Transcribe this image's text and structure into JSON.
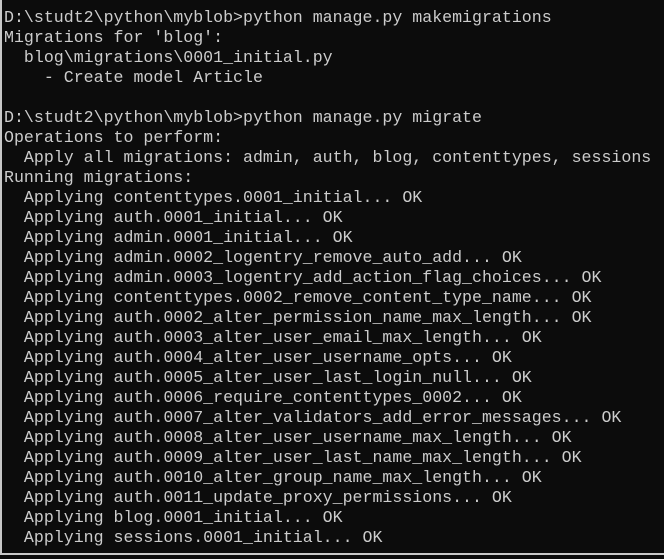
{
  "terminal": {
    "background": "#0c0c0c",
    "foreground": "#cccccc",
    "lines": [
      "D:\\studt2\\python\\myblob>python manage.py makemigrations",
      "Migrations for 'blog':",
      "  blog\\migrations\\0001_initial.py",
      "    - Create model Article",
      "",
      "D:\\studt2\\python\\myblob>python manage.py migrate",
      "Operations to perform:",
      "  Apply all migrations: admin, auth, blog, contenttypes, sessions",
      "Running migrations:",
      "  Applying contenttypes.0001_initial... OK",
      "  Applying auth.0001_initial... OK",
      "  Applying admin.0001_initial... OK",
      "  Applying admin.0002_logentry_remove_auto_add... OK",
      "  Applying admin.0003_logentry_add_action_flag_choices... OK",
      "  Applying contenttypes.0002_remove_content_type_name... OK",
      "  Applying auth.0002_alter_permission_name_max_length... OK",
      "  Applying auth.0003_alter_user_email_max_length... OK",
      "  Applying auth.0004_alter_user_username_opts... OK",
      "  Applying auth.0005_alter_user_last_login_null... OK",
      "  Applying auth.0006_require_contenttypes_0002... OK",
      "  Applying auth.0007_alter_validators_add_error_messages... OK",
      "  Applying auth.0008_alter_user_username_max_length... OK",
      "  Applying auth.0009_alter_user_last_name_max_length... OK",
      "  Applying auth.0010_alter_group_name_max_length... OK",
      "  Applying auth.0011_update_proxy_permissions... OK",
      "  Applying blog.0001_initial... OK",
      "  Applying sessions.0001_initial... OK"
    ]
  }
}
